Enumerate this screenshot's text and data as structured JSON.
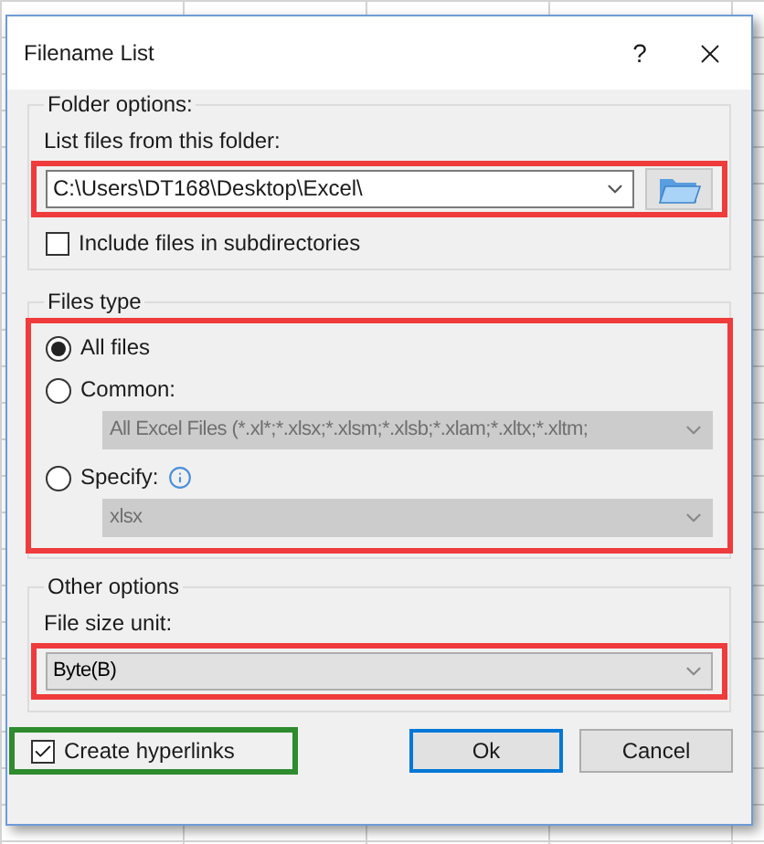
{
  "window": {
    "title": "Filename List",
    "help": "?"
  },
  "folder_options": {
    "legend": "Folder options:",
    "label": "List files from this folder:",
    "path": "C:\\Users\\DT168\\Desktop\\Excel\\",
    "include_subdirectories": {
      "label": "Include files in subdirectories",
      "checked": false
    }
  },
  "files_type": {
    "legend": "Files type",
    "options": [
      {
        "kind": "plain",
        "label": "All files",
        "selected": true
      },
      {
        "kind": "combo",
        "label": "Common:",
        "selected": false,
        "value": "All Excel Files (*.xl*;*.xlsx;*.xlsm;*.xlsb;*.xlam;*.xltx;*.xltm;",
        "disabled": true
      },
      {
        "kind": "combo",
        "label": "Specify:",
        "selected": false,
        "info": true,
        "value": "xlsx",
        "disabled": true
      }
    ]
  },
  "other_options": {
    "legend": "Other options",
    "label": "File size unit:",
    "value": "Byte(B)"
  },
  "create_hyperlinks": {
    "label": "Create hyperlinks",
    "checked": true
  },
  "buttons": [
    {
      "label": "Ok",
      "default": true
    },
    {
      "label": "Cancel",
      "default": false
    }
  ]
}
